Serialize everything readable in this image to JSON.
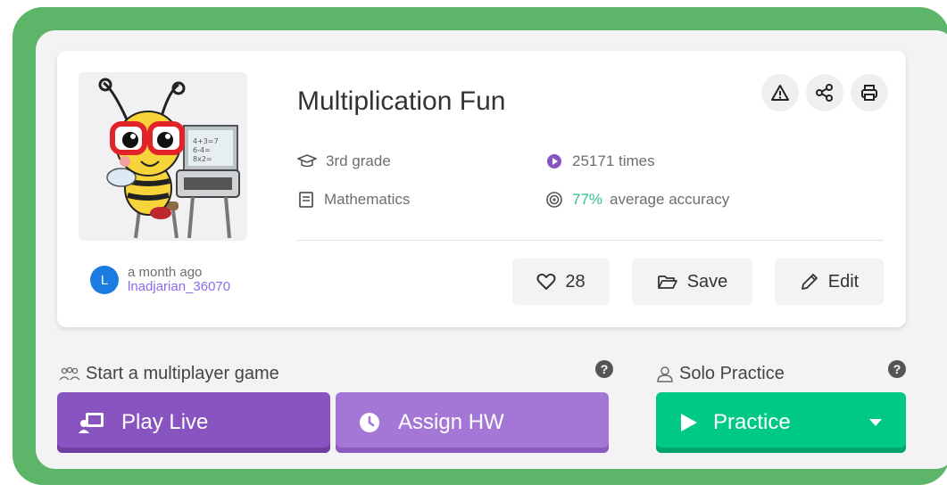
{
  "quiz": {
    "title": "Multiplication Fun",
    "grade": "3rd grade",
    "subject": "Mathematics",
    "plays": "25171 times",
    "accuracy_value": "77%",
    "accuracy_label": "average accuracy"
  },
  "author": {
    "initial": "L",
    "time": "a month ago",
    "username": "lnadjarian_36070"
  },
  "actions": {
    "likes": "28",
    "save": "Save",
    "edit": "Edit"
  },
  "multiplayer": {
    "label": "Start a multiplayer game",
    "play_live": "Play Live",
    "assign_hw": "Assign HW"
  },
  "solo": {
    "label": "Solo Practice",
    "practice": "Practice"
  },
  "help_glyph": "?",
  "colors": {
    "frame": "#5db56a",
    "play_live": "#8854c0",
    "assign_hw": "#a477d6",
    "practice": "#00c985",
    "accuracy": "#2ec28e",
    "username": "#8c6be8",
    "avatar": "#1b7be0"
  },
  "icons": {
    "grade": "graduation-cap-icon",
    "subject": "book-icon",
    "plays": "play-circle-icon",
    "accuracy": "target-icon",
    "report": "warning-icon",
    "share": "share-icon",
    "print": "print-icon",
    "like": "heart-icon",
    "save": "folder-icon",
    "edit": "pencil-icon",
    "multiplayer": "people-icon",
    "solo": "person-icon",
    "play_live": "screen-share-icon",
    "assign_hw": "clock-icon",
    "practice": "play-icon",
    "dropdown": "caret-down-icon"
  }
}
